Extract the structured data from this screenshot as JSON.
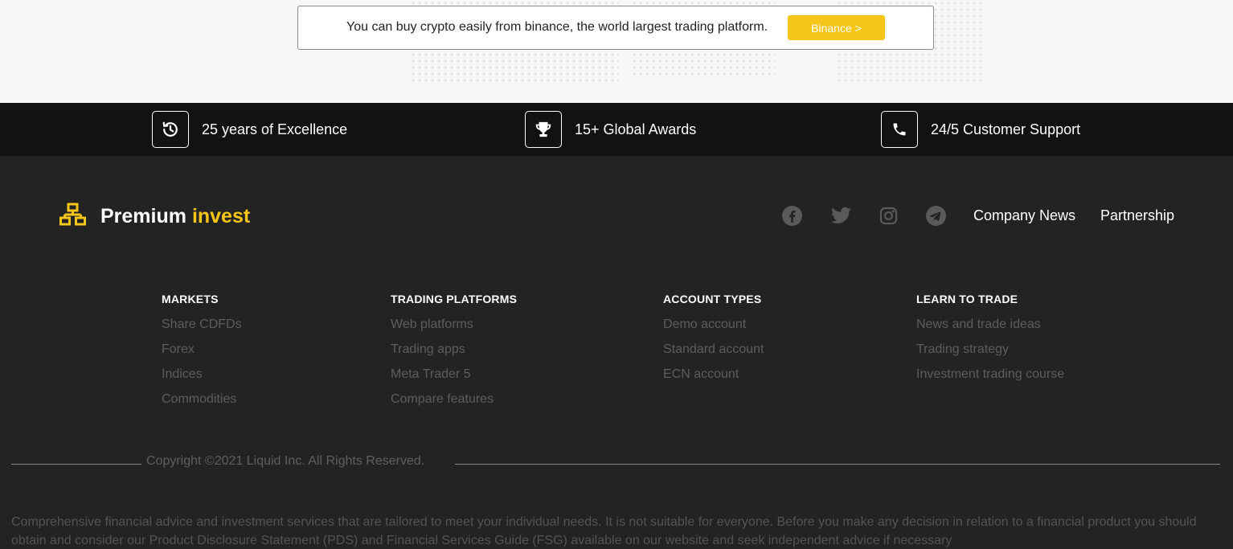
{
  "banner": {
    "text": "You can buy crypto easily from binance, the world largest trading platform.",
    "button_label": "Binance >"
  },
  "features": [
    {
      "icon": "history-icon",
      "label": "25 years of Excellence"
    },
    {
      "icon": "trophy-icon",
      "label": "15+ Global Awards"
    },
    {
      "icon": "phone-icon",
      "label": "24/5 Customer Support"
    }
  ],
  "brand": {
    "name_main": "Premium",
    "name_accent": "invest",
    "icon": "sitemap-icon"
  },
  "social": [
    "facebook-icon",
    "twitter-icon",
    "instagram-icon",
    "telegram-icon"
  ],
  "top_links": [
    "Company News",
    "Partnership"
  ],
  "columns": [
    {
      "heading": "MARKETS",
      "links": [
        "Share CDFDs",
        "Forex",
        "Indices",
        "Commodities"
      ]
    },
    {
      "heading": "TRADING PLATFORMS",
      "links": [
        "Web platforms",
        "Trading apps",
        "Meta Trader 5",
        "Compare features"
      ]
    },
    {
      "heading": "ACCOUNT TYPES",
      "links": [
        "Demo account",
        "Standard account",
        "ECN account"
      ]
    },
    {
      "heading": "LEARN TO TRADE",
      "links": [
        "News and trade ideas",
        "Trading strategy",
        "Investment trading course"
      ]
    }
  ],
  "copyright": "Copyright ©2021 Liquid Inc. All Rights Reserved.",
  "disclaimer": "Comprehensive financial advice and investment services that are tailored to meet your individual needs. It is not suitable for everyone. Before you make any decision in relation to a financial product you should obtain and consider our Product Disclosure Statement (PDS) and Financial Services Guide (FSG) available on our website and seek independent advice if necessary",
  "colors": {
    "accent": "#f5c518",
    "strip_bg": "#101214",
    "footer_bg": "#232323",
    "muted_link": "#5d5d5d"
  }
}
